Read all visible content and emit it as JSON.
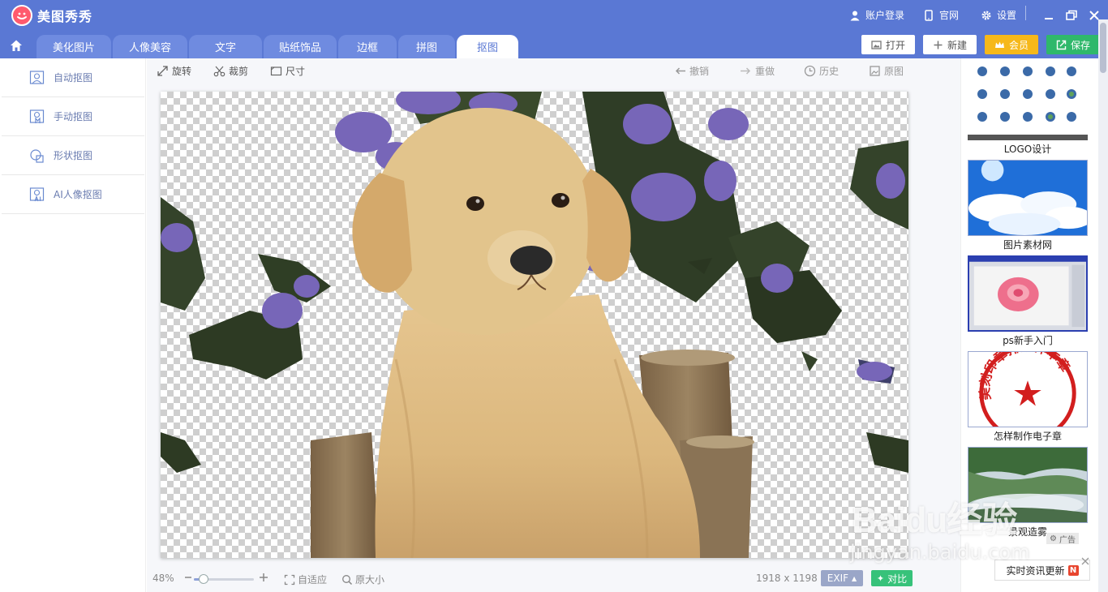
{
  "app": {
    "title": "美图秀秀",
    "title_links": [
      "账户登录",
      "官网",
      "设置"
    ]
  },
  "tabs": [
    "美化图片",
    "人像美容",
    "文字",
    "贴纸饰品",
    "边框",
    "拼图",
    "抠图"
  ],
  "active_tab": "抠图",
  "top_actions": {
    "open": "打开",
    "new": "新建",
    "vip": "会员",
    "save": "保存"
  },
  "left_menu": [
    "自动抠图",
    "手动抠图",
    "形状抠图",
    "AI人像抠图"
  ],
  "toolbar": {
    "rotate": "旋转",
    "crop": "裁剪",
    "size": "尺寸",
    "undo": "撤销",
    "redo": "重做",
    "history": "历史",
    "original": "原图"
  },
  "statusbar": {
    "zoom": "48%",
    "zoom_level": 0.16,
    "fit": "自适应",
    "actual_size": "原大小",
    "dimensions": "1918 x 1198",
    "exif": "EXIF",
    "compare": "对比"
  },
  "promos": [
    {
      "label": "LOGO设计",
      "icon": "logo-icon-grid"
    },
    {
      "label": "图片素材网",
      "icon": "sky-cloud-image"
    },
    {
      "label": "ps新手入门",
      "icon": "rose-screenshot-image"
    },
    {
      "label": "怎样制作电子章",
      "icon": "red-seal-image",
      "seal_text": "美刻印章排版样本章"
    },
    {
      "label": "景观造雾",
      "icon": "fog-landscape-image"
    }
  ],
  "ad_label": "广告",
  "news_toast": {
    "label": "实时资讯更新",
    "badge": "N"
  },
  "watermark": {
    "main": "Baidu经验",
    "sub": "jingyan.baidu.com"
  },
  "colors": {
    "header_blue": "#5a78d4",
    "tab_inactive": "#6f8be0",
    "vip_yellow": "#f6b81a",
    "save_green": "#2fb86b",
    "exif_gray": "#9aa6c8",
    "compare_green": "#37c27a"
  }
}
